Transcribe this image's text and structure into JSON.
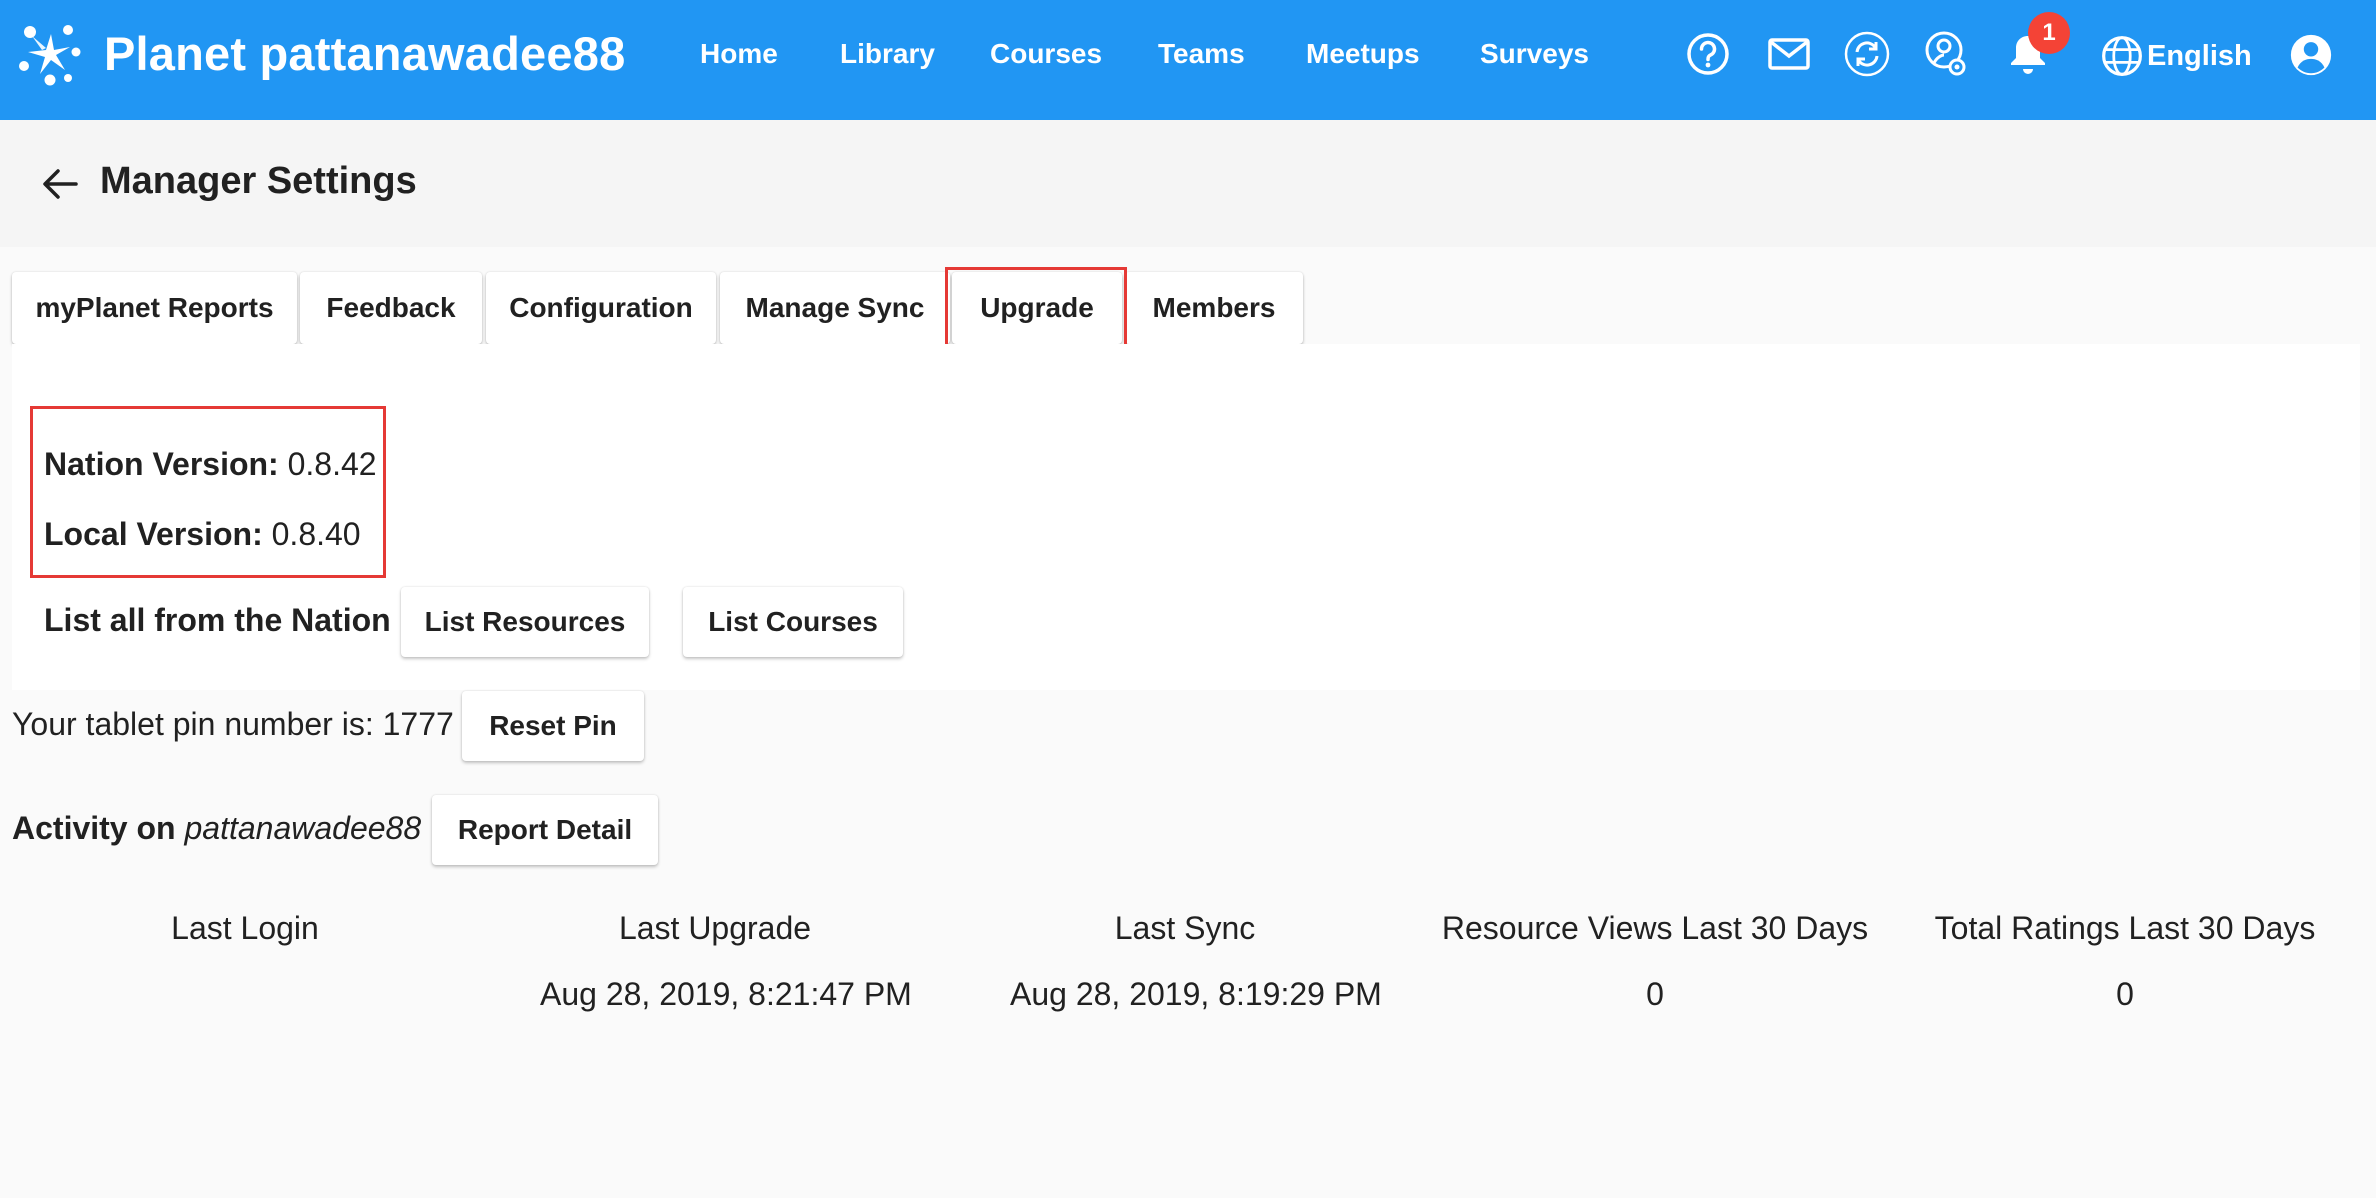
{
  "app": {
    "name": "Planet pattanawadee88"
  },
  "nav": {
    "links": [
      "Home",
      "Library",
      "Courses",
      "Teams",
      "Meetups",
      "Surveys"
    ],
    "notification_count": "1",
    "language": "English",
    "icons": [
      "help-icon",
      "mail-icon",
      "sync-icon",
      "manager-settings-icon",
      "bell-icon",
      "globe-icon",
      "account-icon"
    ]
  },
  "header": {
    "title": "Manager Settings"
  },
  "tabs": [
    "myPlanet Reports",
    "Feedback",
    "Configuration",
    "Manage Sync",
    "Upgrade",
    "Members"
  ],
  "versions": {
    "nation_label": "Nation Version:",
    "nation_value": " 0.8.42",
    "local_label": "Local Version:",
    "local_value": " 0.8.40"
  },
  "list_all": {
    "label": "List all from the Nation",
    "resources_button": "List Resources",
    "courses_button": "List Courses"
  },
  "pin": {
    "text": "Your tablet pin number is: 1777",
    "reset_button": "Reset Pin"
  },
  "activity": {
    "label": "Activity on",
    "planet": "pattanawadee88",
    "report_button": "Report Detail"
  },
  "stats": {
    "headers": [
      "Last Login",
      "Last Upgrade",
      "Last Sync",
      "Resource Views Last 30 Days",
      "Total Ratings Last 30 Days"
    ],
    "values": [
      "",
      "Aug 28, 2019, 8:21:47 PM",
      "Aug 28, 2019, 8:19:29 PM",
      "0",
      "0"
    ]
  },
  "colors": {
    "primary": "#2196f3",
    "badge": "#f44336",
    "highlight": "#e53935"
  }
}
